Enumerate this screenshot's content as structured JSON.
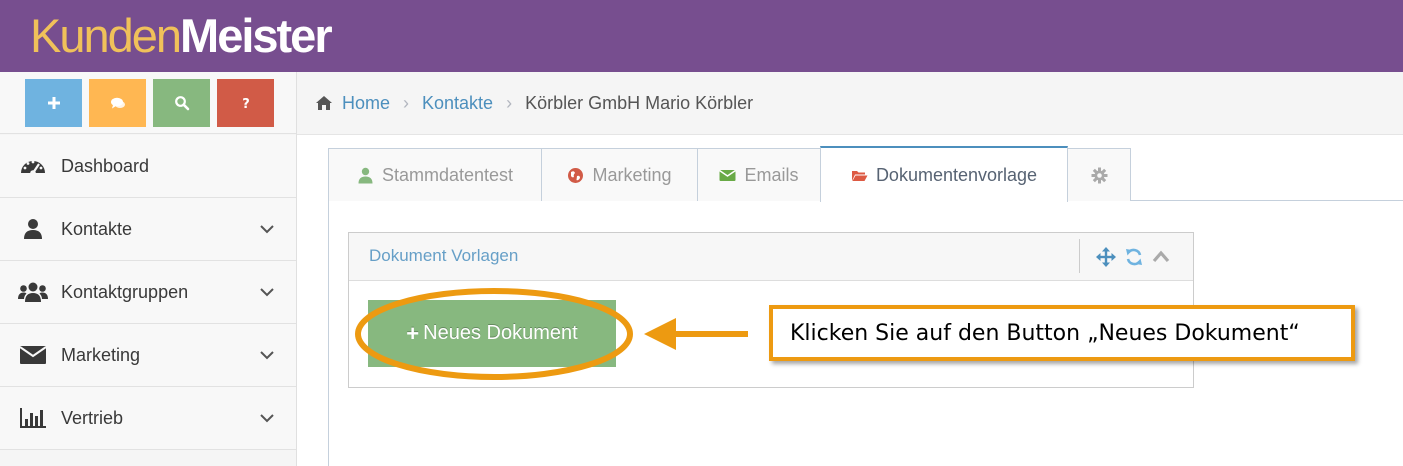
{
  "app": {
    "logo_part1": "Kunden",
    "logo_part2": "Meister"
  },
  "shortcuts": [
    {
      "icon": "plus-icon",
      "color": "#6fb3e0"
    },
    {
      "icon": "comments-icon",
      "color": "#ffb752"
    },
    {
      "icon": "search-icon",
      "color": "#87b87f"
    },
    {
      "icon": "question-icon",
      "color": "#d15b47"
    }
  ],
  "sidebar": {
    "items": [
      {
        "label": "Dashboard",
        "icon": "dashboard-icon"
      },
      {
        "label": "Kontakte",
        "icon": "user-icon"
      },
      {
        "label": "Kontaktgruppen",
        "icon": "users-icon"
      },
      {
        "label": "Marketing",
        "icon": "envelope-icon"
      },
      {
        "label": "Vertrieb",
        "icon": "bar-chart-icon"
      }
    ]
  },
  "breadcrumb": {
    "home": "Home",
    "contacts": "Kontakte",
    "current": "Körbler GmbH Mario Körbler"
  },
  "tabs": [
    {
      "label": "Stammdatentest",
      "icon": "user-icon",
      "color": "#87b87f"
    },
    {
      "label": "Marketing",
      "icon": "globe-icon",
      "color": "#d15b47"
    },
    {
      "label": "Emails",
      "icon": "envelope-icon",
      "color": "#69aa46"
    },
    {
      "label": "Dokumentenvorlage",
      "icon": "folder-open-icon",
      "color": "#dd5a43"
    },
    {
      "label": "",
      "icon": "gear-icon",
      "color": "#aaaaaa"
    }
  ],
  "widget": {
    "title": "Dokument Vorlagen",
    "button_label": "Neues Dokument"
  },
  "annotation": {
    "text": "Klicken Sie auf den Button „Neues Dokument“",
    "color": "#ed9a11"
  },
  "colors": {
    "header": "#774e8f",
    "logo_accent": "#f0c15a",
    "link": "#4c8fbd"
  }
}
